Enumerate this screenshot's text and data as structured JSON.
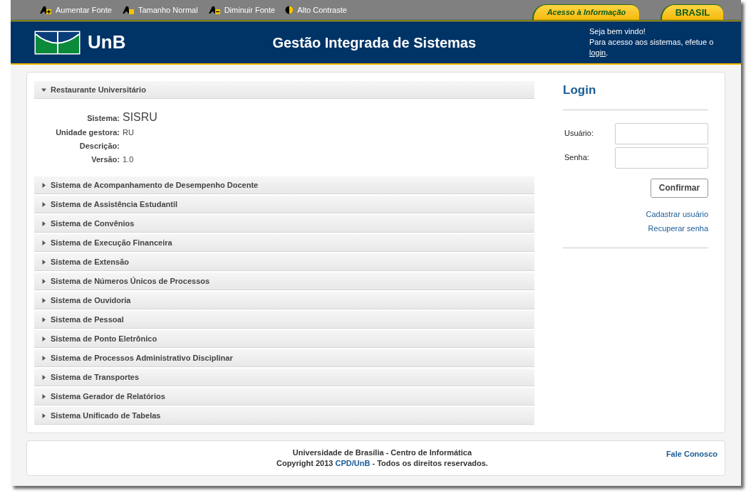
{
  "accessibility_bar": {
    "items": [
      {
        "kind": "increase",
        "label": "Aumentar Fonte"
      },
      {
        "kind": "normal",
        "label": "Tamanho Normal"
      },
      {
        "kind": "decrease",
        "label": "Diminuir Fonte"
      },
      {
        "kind": "contrast",
        "label": "Alto Contraste"
      }
    ],
    "tabs": [
      "Acesso à Informação",
      "BRASIL"
    ]
  },
  "header": {
    "logo_text": "UnB",
    "title": "Gestão Integrada de Sistemas",
    "welcome": "Seja bem vindo!",
    "access_text": "Para acesso aos sistemas, efetue o",
    "login_link": "login",
    "access_suffix": "."
  },
  "systems": [
    {
      "name": "Restaurante Universitário",
      "expanded": true,
      "details": [
        {
          "kind": "title",
          "label": "Sistema:",
          "value": "SISRU"
        },
        {
          "kind": "plain",
          "label": "Unidade gestora:",
          "value": "RU"
        },
        {
          "kind": "plain",
          "label": "Descrição:"
        },
        {
          "kind": "plain",
          "label": "Versão:",
          "value": "1.0"
        }
      ]
    },
    {
      "name": "Sistema de Acompanhamento de Desempenho Docente",
      "expanded": false
    },
    {
      "name": "Sistema de Assistência Estudantil",
      "expanded": false
    },
    {
      "name": "Sistema de Convênios",
      "expanded": false
    },
    {
      "name": "Sistema de Execução Financeira",
      "expanded": false
    },
    {
      "name": "Sistema de Extensão",
      "expanded": false
    },
    {
      "name": "Sistema de Números Únicos de Processos",
      "expanded": false
    },
    {
      "name": "Sistema de Ouvidoria",
      "expanded": false
    },
    {
      "name": "Sistema de Pessoal",
      "expanded": false
    },
    {
      "name": "Sistema de Ponto Eletrônico",
      "expanded": false
    },
    {
      "name": "Sistema de Processos Administrativo Disciplinar",
      "expanded": false
    },
    {
      "name": "Sistema de Transportes",
      "expanded": false
    },
    {
      "name": "Sistema Gerador de Relatórios",
      "expanded": false
    },
    {
      "name": "Sistema Unificado de Tabelas",
      "expanded": false
    }
  ],
  "login": {
    "title": "Login",
    "fields": [
      {
        "label": "Usuário:"
      },
      {
        "label": "Senha:"
      }
    ],
    "button": "Confirmar",
    "links": [
      "Cadastrar usuário",
      "Recuperar senha"
    ]
  },
  "footer": {
    "line1": "Universidade de Brasília - Centro de Informática",
    "line2_prefix": "Copyright 2013",
    "line2_link": "CPD/UnB",
    "line2_suffix": "- Todos os direitos reservados.",
    "contact": "Fale Conosco"
  }
}
